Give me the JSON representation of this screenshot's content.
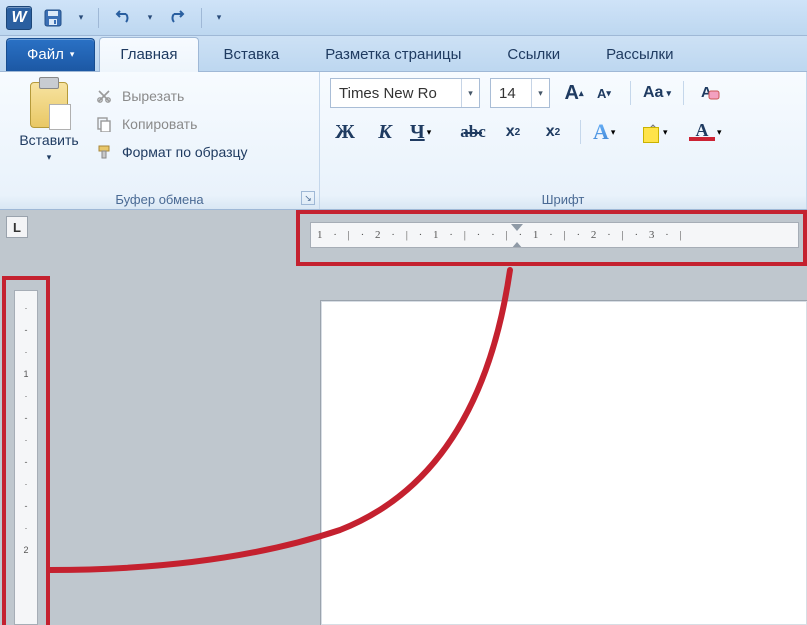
{
  "titlebar": {
    "app_letter": "W"
  },
  "tabs": {
    "file": "Файл",
    "home": "Главная",
    "insert": "Вставка",
    "layout": "Разметка страницы",
    "references": "Ссылки",
    "mailings": "Рассылки"
  },
  "clipboard": {
    "paste": "Вставить",
    "cut": "Вырезать",
    "copy": "Копировать",
    "format_painter": "Формат по образцу",
    "group_label": "Буфер обмена"
  },
  "font": {
    "name": "Times New Ro",
    "size": "14",
    "bold": "Ж",
    "italic": "К",
    "underline": "Ч",
    "strike": "abc",
    "subscript_base": "x",
    "subscript_sub": "2",
    "superscript_base": "x",
    "superscript_sup": "2",
    "case": "Aa",
    "grow_base": "A",
    "shrink_base": "A",
    "text_effects": "A",
    "font_color_letter": "A",
    "group_label": "Шрифт"
  },
  "ruler": {
    "h_text": "1 · | · 2 · | · 1 · | ·   · | · 1 · | · 2 · | · 3 · |",
    "tab_stop_glyph": "L"
  },
  "colors": {
    "annotation": "#c4212f",
    "font_color": "#c02030",
    "highlight": "#ffe34a"
  }
}
